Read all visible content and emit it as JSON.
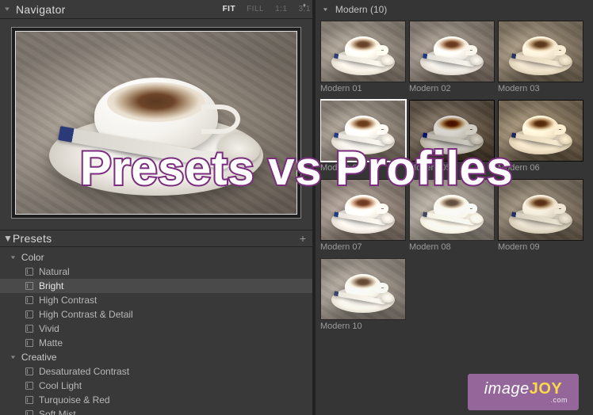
{
  "navigator": {
    "title": "Navigator",
    "zoom": {
      "options": [
        "FIT",
        "FILL",
        "1:1",
        "3:1"
      ],
      "active": "FIT"
    }
  },
  "presets_panel": {
    "title": "Presets",
    "groups": [
      {
        "name": "Color",
        "items": [
          "Natural",
          "Bright",
          "High Contrast",
          "High Contrast & Detail",
          "Vivid",
          "Matte"
        ],
        "selected": "Bright"
      },
      {
        "name": "Creative",
        "items": [
          "Desaturated Contrast",
          "Cool Light",
          "Turquoise & Red",
          "Soft Mist"
        ]
      }
    ]
  },
  "profile_browser": {
    "group_label": "Modern (10)",
    "selected_index": 3,
    "items": [
      {
        "label": "Modern 01",
        "filter_class": "f1"
      },
      {
        "label": "Modern 02",
        "filter_class": "f2"
      },
      {
        "label": "Modern 03",
        "filter_class": "f3"
      },
      {
        "label": "Modern 04",
        "filter_class": "f4"
      },
      {
        "label": "Modern 05",
        "filter_class": "f5"
      },
      {
        "label": "Modern 06",
        "filter_class": "f6"
      },
      {
        "label": "Modern 07",
        "filter_class": "f7"
      },
      {
        "label": "Modern 08",
        "filter_class": "f8"
      },
      {
        "label": "Modern 09",
        "filter_class": "f9"
      },
      {
        "label": "Modern 10",
        "filter_class": "f10"
      }
    ]
  },
  "overlay": {
    "text": "Presets vs Profiles"
  },
  "watermark": {
    "prefix": "image",
    "suffix": "JOY",
    "domain": ".com"
  }
}
